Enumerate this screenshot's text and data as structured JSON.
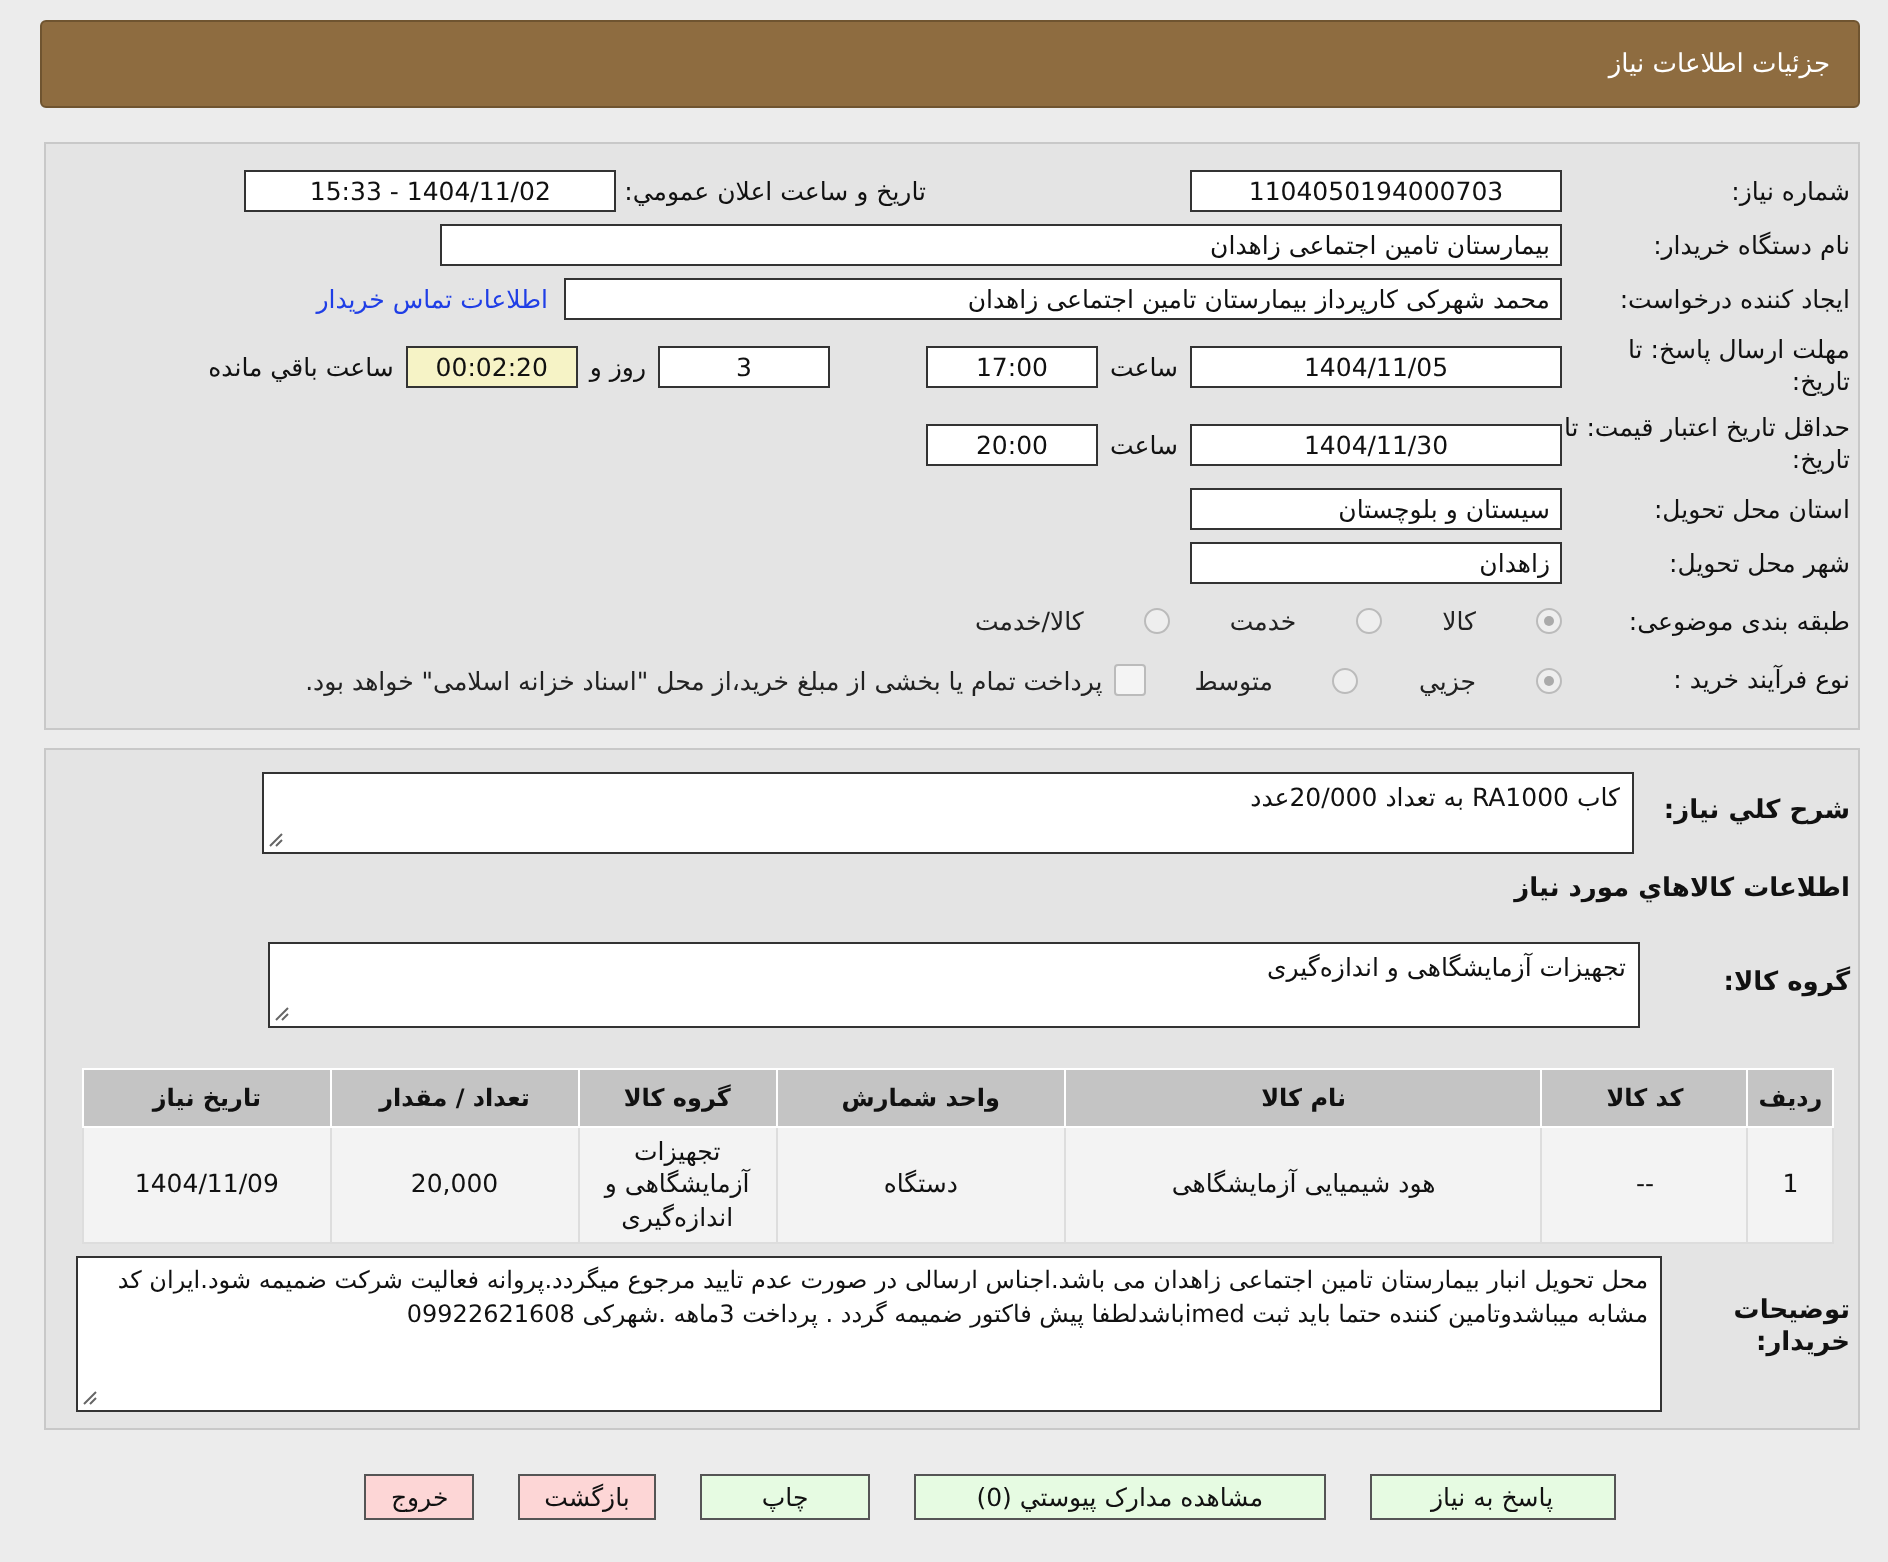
{
  "header": {
    "title": "جزئیات اطلاعات نیاز"
  },
  "need_number": {
    "label": "شماره نیاز:",
    "value": "1104050194000703"
  },
  "announce": {
    "label": "تاریخ و ساعت اعلان عمومي:",
    "value": "1404/11/02 - 15:33"
  },
  "buyer": {
    "label": "نام دستگاه خریدار:",
    "value": "بیمارستان تامین اجتماعی زاهدان"
  },
  "requester": {
    "label": "ایجاد کننده درخواست:",
    "value": "محمد شهرکی کارپرداز بیمارستان تامین اجتماعی زاهدان",
    "link": "اطلاعات تماس خریدار"
  },
  "deadline": {
    "label": "مهلت ارسال پاسخ: تا تاریخ:",
    "date": "1404/11/05",
    "time_label": "ساعت",
    "time": "17:00",
    "days": "3",
    "days_label": "روز و",
    "remaining": "00:02:20",
    "remaining_label": "ساعت باقي مانده"
  },
  "validity": {
    "label": "حداقل تاریخ اعتبار قیمت: تا تاریخ:",
    "date": "1404/11/30",
    "time_label": "ساعت",
    "time": "20:00"
  },
  "province": {
    "label": "استان محل تحویل:",
    "value": "سیستان و بلوچستان"
  },
  "city": {
    "label": "شهر محل تحویل:",
    "value": "زاهدان"
  },
  "category": {
    "label": "طبقه بندی موضوعی:",
    "options": [
      {
        "label": "کالا",
        "selected": true
      },
      {
        "label": "خدمت",
        "selected": false
      },
      {
        "label": "کالا/خدمت",
        "selected": false
      }
    ]
  },
  "process": {
    "label": "نوع فرآیند خرید :",
    "options": [
      {
        "label": "جزيي",
        "selected": true
      },
      {
        "label": "متوسط",
        "selected": false
      }
    ],
    "payment": {
      "label": "پرداخت تمام یا بخشی از مبلغ خرید،از محل \"اسناد خزانه اسلامی\" خواهد بود.",
      "checked": false
    }
  },
  "description": {
    "label": "شرح کلي نیاز:",
    "value": "کاب RA1000 به تعداد 20/000عدد"
  },
  "goods_heading": "اطلاعات کالاهاي مورد نیاز",
  "goods_group": {
    "label": "گروه کالا:",
    "value": "تجهیزات آزمایشگاهی و اندازه‌گیری"
  },
  "table": {
    "columns": [
      "ردیف",
      "کد کالا",
      "نام کالا",
      "واحد شمارش",
      "گروه کالا",
      "تعداد / مقدار",
      "تاریخ نیاز"
    ],
    "rows": [
      [
        "1",
        "--",
        "هود شیمیایی آزمایشگاهی",
        "دستگاه",
        "تجهیزات آزمایشگاهی و اندازه‌گیری",
        "20,000",
        "1404/11/09"
      ]
    ]
  },
  "buyer_notes": {
    "label": "توضیحات خریدار:",
    "value": "محل تحویل انبار بیمارستان تامین اجتماعی زاهدان می باشد.اجناس ارسالی در صورت عدم تایید مرجوع میگردد.پروانه فعالیت شرکت ضمیمه شود.ایران کد مشابه میباشدوتامین کننده حتما باید ثبت imedباشدلطفا پیش فاکتور ضمیمه گردد . پرداخت 3ماهه  .شهرکی 09922621608"
  },
  "buttons": [
    {
      "label": "پاسخ به نیاز",
      "kind": "normal"
    },
    {
      "label": "مشاهده مدارک پیوستي (0)",
      "kind": "normal"
    },
    {
      "label": "چاپ",
      "kind": "normal"
    },
    {
      "label": "بازگشت",
      "kind": "danger"
    },
    {
      "label": "خروج",
      "kind": "danger"
    }
  ]
}
